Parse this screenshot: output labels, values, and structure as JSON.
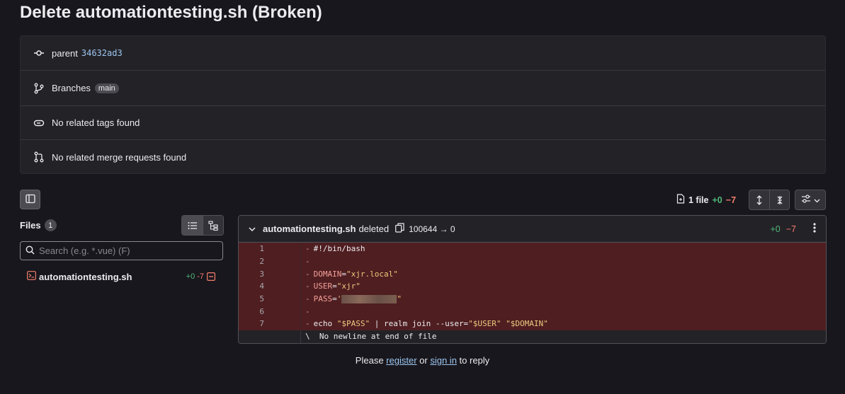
{
  "page": {
    "title": "Delete automationtesting.sh (Broken)"
  },
  "meta": {
    "parent_label": "parent",
    "parent_sha": "34632ad3",
    "branches_label": "Branches",
    "branch_badge": "main",
    "tags_text": "No related tags found",
    "mr_text": "No related merge requests found"
  },
  "toolbar": {
    "files_count_text": "1 file",
    "additions": "+0",
    "deletions": "−7"
  },
  "files_panel": {
    "heading": "Files",
    "count": "1",
    "search_placeholder": "Search (e.g. *.vue) (F)",
    "items": [
      {
        "name": "automationtesting.sh",
        "additions": "+0",
        "deletions": "-7"
      }
    ]
  },
  "diff": {
    "filename": "automationtesting.sh",
    "status": "deleted",
    "mode_change": "100644 → 0",
    "additions": "+0",
    "deletions": "−7",
    "lines": [
      {
        "num": "1",
        "text": "#!/bin/bash"
      },
      {
        "num": "2",
        "text": ""
      },
      {
        "num": "3",
        "key": "DOMAIN",
        "value": "\"xjr.local\""
      },
      {
        "num": "4",
        "key": "USER",
        "value": "\"xjr\""
      },
      {
        "num": "5",
        "key": "PASS",
        "value_open": "'",
        "value_close": "\""
      },
      {
        "num": "6",
        "text": ""
      },
      {
        "num": "7",
        "echo": "echo ",
        "p1": "\"$PASS\"",
        "mid": " | realm join --user=",
        "p2": "\"$USER\"",
        "sp": " ",
        "p3": "\"$DOMAIN\""
      }
    ],
    "no_newline": "\\  No newline at end of file"
  },
  "reply": {
    "prefix": "Please",
    "register": "register",
    "or": "or",
    "sign_in": "sign in",
    "suffix": "to reply"
  },
  "colors": {
    "background": "#18171d",
    "card": "#232227",
    "additions": "#52b87a",
    "deletions": "#f57f6c",
    "deleted_line_bg": "#4f1e21",
    "link": "#9dc7f1"
  }
}
